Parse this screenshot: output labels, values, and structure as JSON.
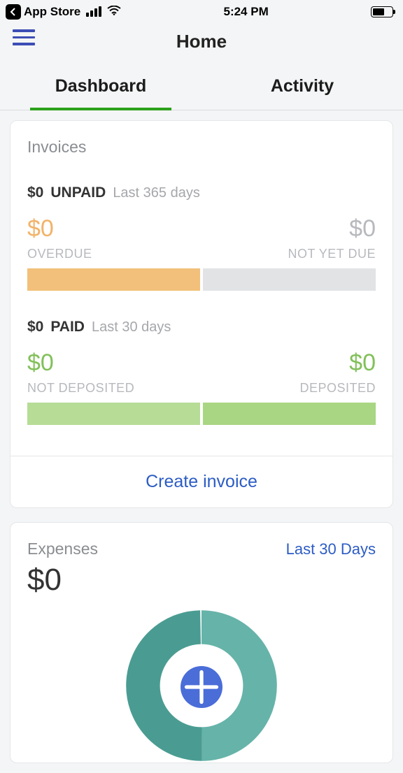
{
  "status_bar": {
    "back_label": "App Store",
    "time": "5:24 PM"
  },
  "nav": {
    "title": "Home"
  },
  "tabs": {
    "dashboard": "Dashboard",
    "activity": "Activity"
  },
  "invoices": {
    "title": "Invoices",
    "unpaid": {
      "amount": "$0",
      "label": "UNPAID",
      "period": "Last 365 days",
      "overdue_val": "$0",
      "overdue_lbl": "OVERDUE",
      "notdue_val": "$0",
      "notdue_lbl": "NOT YET DUE"
    },
    "paid": {
      "amount": "$0",
      "label": "PAID",
      "period": "Last 30 days",
      "notdep_val": "$0",
      "notdep_lbl": "NOT DEPOSITED",
      "dep_val": "$0",
      "dep_lbl": "DEPOSITED"
    },
    "action": "Create invoice"
  },
  "expenses": {
    "title": "Expenses",
    "period": "Last 30 Days",
    "amount": "$0"
  }
}
